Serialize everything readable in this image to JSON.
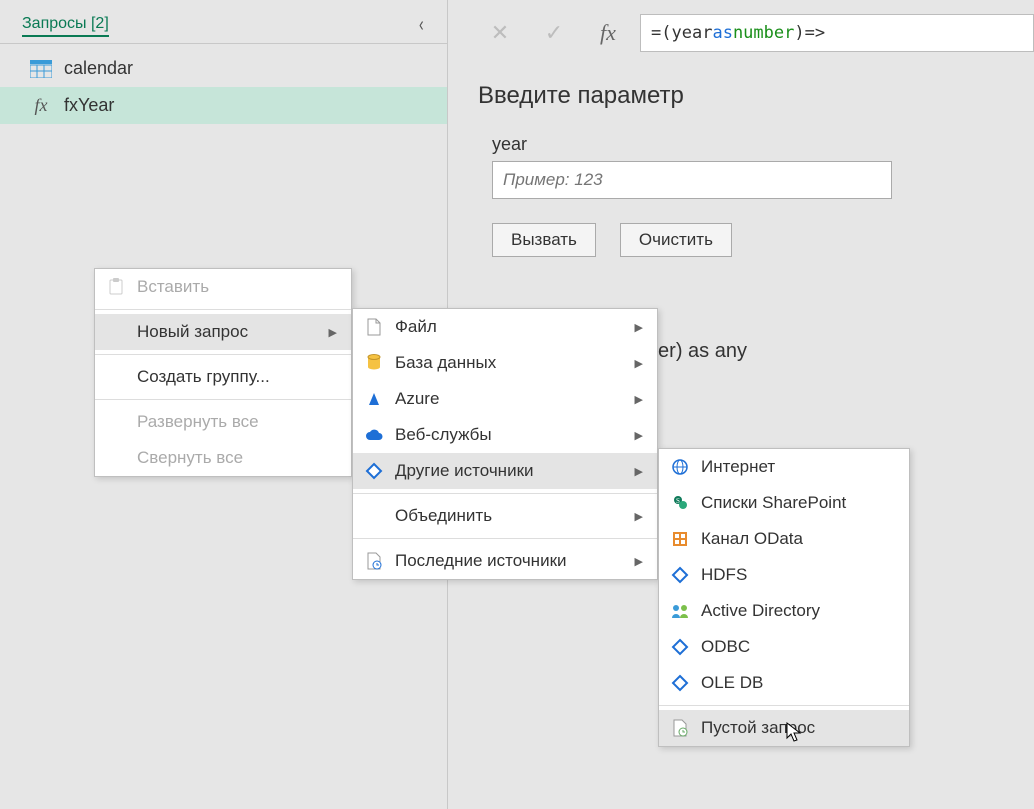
{
  "sidebar": {
    "header": "Запросы [2]",
    "items": [
      {
        "label": "calendar"
      },
      {
        "label": "fxYear"
      }
    ]
  },
  "formula": {
    "eq": "= ",
    "open": "(",
    "ident": "year ",
    "kw": "as ",
    "type": "number",
    "close": ")=>"
  },
  "param": {
    "title": "Введите параметр",
    "label": "year",
    "placeholder": "Пример: 123",
    "invoke": "Вызвать",
    "clear": "Очистить"
  },
  "signature": "number) as any",
  "context_menu": {
    "paste": "Вставить",
    "new_query": "Новый запрос",
    "create_group": "Создать группу...",
    "expand_all": "Развернуть все",
    "collapse_all": "Свернуть все"
  },
  "new_query_menu": {
    "file": "Файл",
    "database": "База данных",
    "azure": "Azure",
    "web_services": "Веб-службы",
    "other_sources": "Другие источники",
    "combine": "Объединить",
    "recent_sources": "Последние источники"
  },
  "other_sources_menu": {
    "internet": "Интернет",
    "sharepoint": "Списки SharePoint",
    "odata": "Канал OData",
    "hdfs": "HDFS",
    "active_directory": "Active Directory",
    "odbc": "ODBC",
    "oledb": "OLE DB",
    "blank_query": "Пустой запрос"
  }
}
